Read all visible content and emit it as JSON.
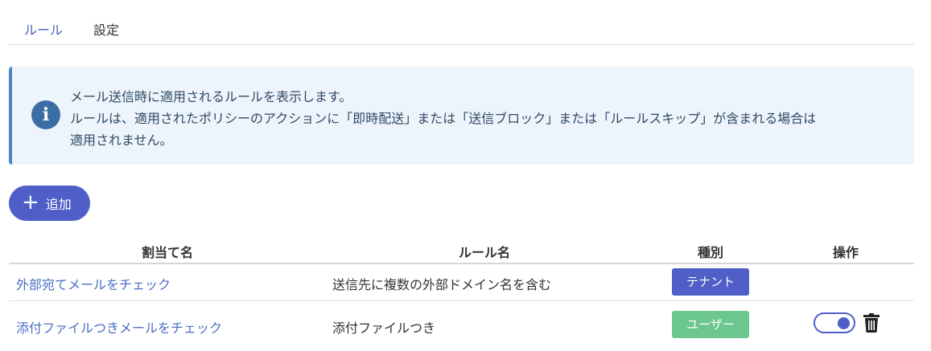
{
  "tabs": [
    {
      "label": "ルール"
    },
    {
      "label": "設定"
    }
  ],
  "info": {
    "icon": "info-icon",
    "lines": [
      "メール送信時に適用されるルールを表示します。",
      "ルールは、適用されたポリシーのアクションに「即時配送」または「送信ブロック」または「ルールスキップ」が含まれる場合は",
      "適用されません。"
    ]
  },
  "add_button": {
    "label": "追加",
    "icon": "plus-icon"
  },
  "table": {
    "headers": [
      "割当て名",
      "ルール名",
      "種別",
      "操作"
    ],
    "rows": [
      {
        "assignment": "外部宛てメールをチェック",
        "rule": "送信先に複数の外部ドメイン名を含む",
        "type": "テナント",
        "type_color": "#4f5fc7",
        "has_actions": false
      },
      {
        "assignment": "添付ファイルつきメールをチェック",
        "rule": "添付ファイルつき",
        "type": "ユーザー",
        "type_color": "#6cc78e",
        "has_actions": true,
        "toggle_on": true
      }
    ]
  },
  "colors": {
    "accent": "#4f5fc7",
    "info_border": "#4a86c5",
    "info_bg": "#eef4fb",
    "link": "#4a6fc2"
  }
}
